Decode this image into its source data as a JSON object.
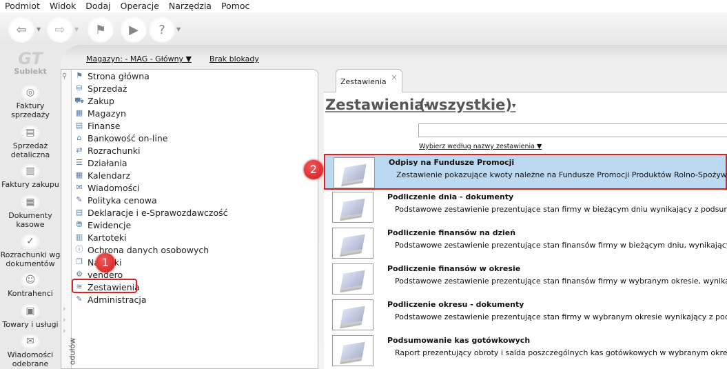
{
  "menu": [
    "Podmiot",
    "Widok",
    "Dodaj",
    "Operacje",
    "Narzędzia",
    "Pomoc"
  ],
  "toolbar_icons": [
    "back-icon",
    "forward-icon",
    "home-flag-icon",
    "reports-icon",
    "help-icon"
  ],
  "logo": {
    "mark": "GT",
    "name": "Subiekt"
  },
  "sidebar": [
    {
      "label": "Faktury sprzedaży",
      "icon": "coins-icon"
    },
    {
      "label": "Sprzedaż detaliczna",
      "icon": "register-icon"
    },
    {
      "label": "Faktury zakupu",
      "icon": "invoice-icon"
    },
    {
      "label": "Dokumenty kasowe",
      "icon": "cash-icon"
    },
    {
      "label": "Rozrachunki wg dokumentów",
      "icon": "settlements-icon"
    },
    {
      "label": "Kontrahenci",
      "icon": "person-icon"
    },
    {
      "label": "Towary i usługi",
      "icon": "goods-icon"
    },
    {
      "label": "Wiadomości odebrane",
      "icon": "messages-icon"
    }
  ],
  "header": {
    "warehouse": "Magazyn: - MAG - Główny",
    "lock": "Brak blokady"
  },
  "modules_label": "odułów",
  "modules": [
    "Strona główna",
    "Sprzedaż",
    "Zakup",
    "Magazyn",
    "Finanse",
    "Bankowość on-line",
    "Rozrachunki",
    "Działania",
    "Kalendarz",
    "Wiadomości",
    "Polityka cenowa",
    "Deklaracje i e-Sprawozdawczość",
    "Ewidencje",
    "Kartoteki",
    "Ochrona danych osobowych",
    "Naklejki",
    "vendero",
    "Zestawienia",
    "Administracja"
  ],
  "badges": [
    "1",
    "2"
  ],
  "tab": {
    "label": "Zestawienia",
    "close": "×"
  },
  "main": {
    "title": "Zestawienia",
    "filter": "(wszystkie)",
    "search_value": "",
    "pick_label": "Wybierz według nazwy zestawienia"
  },
  "reports": [
    {
      "name": "Odpisy na Fundusze Promocji",
      "desc": "Zestawienie pokazujące kwoty należne na Fundusze Promocji Produktów Rolno-Spożywczych",
      "selected": true
    },
    {
      "name": "Podliczenie dnia - dokumenty",
      "desc": "Podstawowe zestawienie prezentujące stan firmy w bieżącym dniu wynikający z podsumowani"
    },
    {
      "name": "Podliczenie finansów na dzień",
      "desc": "Podstawowe zestawienie prezentujące stan finansów firmy w bieżącym dniu, wynikający z pod"
    },
    {
      "name": "Podliczenie finansów w okresie",
      "desc": "Podstawowe zestawienie prezentujące stan finansów firmy w wybranym okresie, wynikający z"
    },
    {
      "name": "Podliczenie okresu - dokumenty",
      "desc": "Podstawowe zestawienie prezentujące stan firmy w wybranym okresie wynikający z podsumo"
    },
    {
      "name": "Podsumowanie kas gotówkowych",
      "desc": "Raport prezentujący obroty i salda poszczególnych kas gotówkowych w wybranym okresie."
    }
  ],
  "colors": {
    "selected_row": "#bcd9f2",
    "highlight": "#e02020"
  }
}
